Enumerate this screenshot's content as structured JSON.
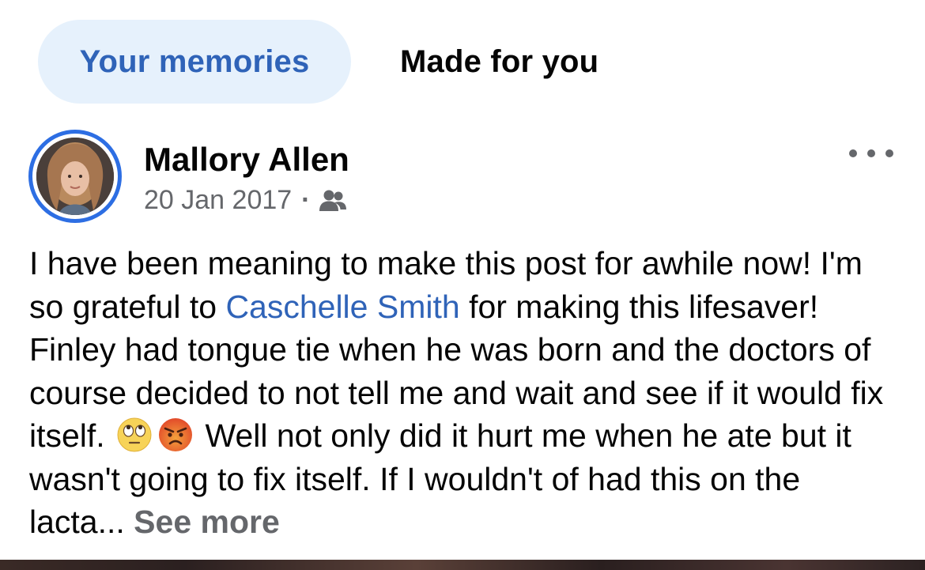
{
  "tabs": {
    "your_memories": "Your memories",
    "made_for_you": "Made for you"
  },
  "post": {
    "author": "Mallory Allen",
    "date": "20 Jan 2017",
    "separator": "·",
    "audience_icon": "friends-icon",
    "more_icon": "more-options-icon",
    "text_part1": "I have been meaning to make this post for awhile now! I'm so grateful to ",
    "mention": "Caschelle Smith",
    "text_part2": " for making this lifesaver! Finley had tongue tie when he was born and the doctors of course decided to not tell me and wait and see if it would fix itself. ",
    "emoji_1": "eye-roll-emoji",
    "emoji_2": "angry-face-emoji",
    "text_part3": " Well not only did it hurt me when he ate but it wasn't going to fix itself. If I wouldn't of had this on the lacta... ",
    "see_more": "See more"
  },
  "colors": {
    "accent": "#2f63b8",
    "tab_active_bg": "#e6f1fc",
    "avatar_ring": "#2d6ee3",
    "secondary_text": "#65676b"
  }
}
